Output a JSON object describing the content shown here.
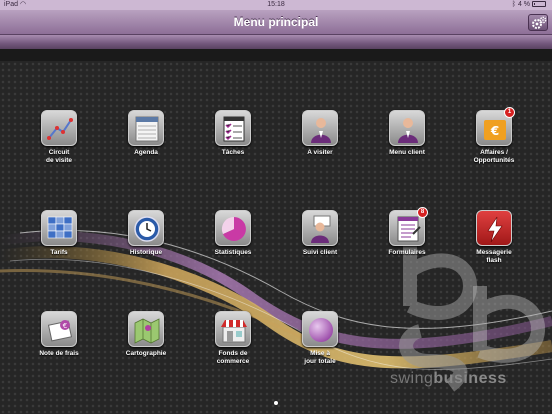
{
  "status": {
    "carrier": "iPad",
    "time": "15:18",
    "battery": "4 %"
  },
  "nav": {
    "title": "Menu principal"
  },
  "tiles": [
    {
      "label": "Circuit\nde visite"
    },
    {
      "label": "Agenda"
    },
    {
      "label": "Tâches"
    },
    {
      "label": "A visiter"
    },
    {
      "label": "Menu client"
    },
    {
      "label": "Affaires /\nOpportunités",
      "badge": "1"
    },
    {
      "label": "Tarifs"
    },
    {
      "label": "Historique"
    },
    {
      "label": "Statistiques"
    },
    {
      "label": "Suivi client"
    },
    {
      "label": "Formulaires",
      "badge": "8"
    },
    {
      "label": "Messagerie\nflash"
    },
    {
      "label": "Note de frais"
    },
    {
      "label": "Cartographie"
    },
    {
      "label": "Fonds de\ncommerce"
    },
    {
      "label": "Mise à\njour totale"
    }
  ],
  "brand": {
    "light": "swing",
    "bold": "business"
  },
  "colors": {
    "nav_top": "#b9a1c0",
    "nav_bottom": "#8d6f97",
    "background": "#262626",
    "badge": "#d62020"
  }
}
